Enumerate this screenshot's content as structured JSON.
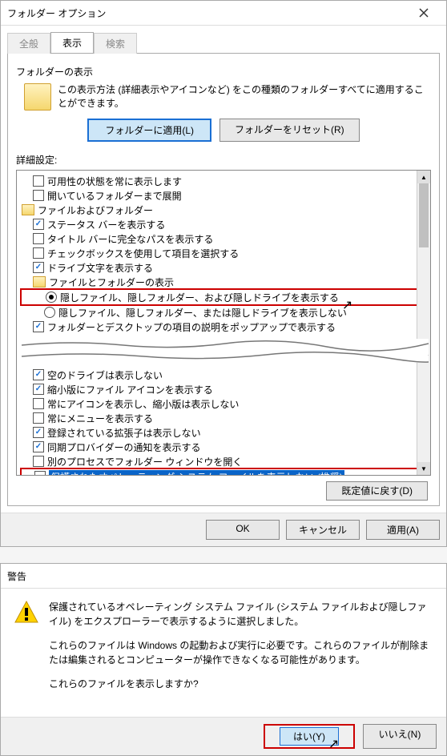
{
  "dlg": {
    "title": "フォルダー オプション",
    "tabs": {
      "t1": "全般",
      "t2": "表示",
      "t3": "検索"
    },
    "group": "フォルダーの表示",
    "desc": "この表示方法 (詳細表示やアイコンなど) をこの種類のフォルダーすべてに適用することができます。",
    "apply_folders": "フォルダーに適用(L)",
    "reset_folders": "フォルダーをリセット(R)",
    "adv": "詳細設定:",
    "restore": "既定値に戻す(D)",
    "ok": "OK",
    "cancel": "キャンセル",
    "apply": "適用(A)"
  },
  "tree": {
    "i0": "可用性の状態を常に表示します",
    "i1": "開いているフォルダーまで展開",
    "i2": "ファイルおよびフォルダー",
    "i3": "ステータス バーを表示する",
    "i4": "タイトル バーに完全なパスを表示する",
    "i5": "チェックボックスを使用して項目を選択する",
    "i6": "ドライブ文字を表示する",
    "i7": "ファイルとフォルダーの表示",
    "i8": "隠しファイル、隠しフォルダー、および隠しドライブを表示する",
    "i9": "隠しファイル、隠しフォルダー、または隠しドライブを表示しない",
    "i10": "フォルダーとデスクトップの項目の説明をポップアップで表示する",
    "i11": "空のドライブは表示しない",
    "i12": "縮小版にファイル アイコンを表示する",
    "i13": "常にアイコンを表示し、縮小版は表示しない",
    "i14": "常にメニューを表示する",
    "i15": "登録されている拡張子は表示しない",
    "i16": "同期プロバイダーの通知を表示する",
    "i17": "別のプロセスでフォルダー ウィンドウを開く",
    "i18": "保護されたオペレーティング システム ファイルを表示しない (推奨)"
  },
  "warn": {
    "title": "警告",
    "p1": "保護されているオペレーティング システム ファイル (システム ファイルおよび隠しファイル) をエクスプローラーで表示するように選択しました。",
    "p2": "これらのファイルは Windows の起動および実行に必要です。これらのファイルが削除または編集されるとコンピューターが操作できなくなる可能性があります。",
    "p3": "これらのファイルを表示しますか?",
    "yes": "はい(Y)",
    "no": "いいえ(N)"
  }
}
